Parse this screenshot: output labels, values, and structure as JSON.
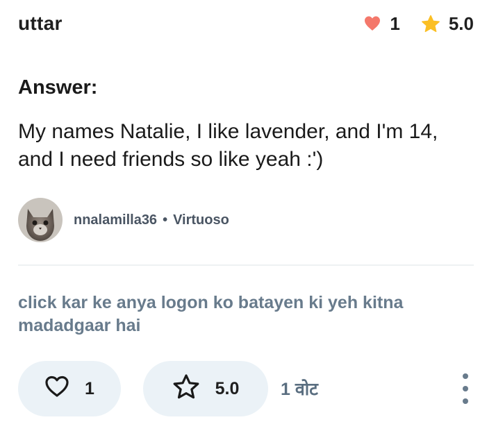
{
  "question": {
    "title": "uttar"
  },
  "stats": {
    "likes": "1",
    "rating": "5.0"
  },
  "answer": {
    "label": "Answer:",
    "text": "My names Natalie, I like lavender, and I'm 14, and I need friends so like yeah :')"
  },
  "author": {
    "username": "nnalamilla36",
    "separator": "•",
    "rank": "Virtuoso"
  },
  "helpful_prompt": "click kar ke anya logon ko batayen ki yeh kitna madadgaar hai",
  "actions": {
    "like_count": "1",
    "rating_value": "5.0",
    "votes_label": "1 वोट"
  },
  "colors": {
    "heart": "#f4786b",
    "star": "#fbbf24",
    "pill_bg": "#ebf2f7",
    "muted_text": "#687b8c"
  },
  "icons": [
    "heart-icon",
    "star-icon",
    "heart-outline-icon",
    "star-outline-icon",
    "more-vertical-icon"
  ]
}
